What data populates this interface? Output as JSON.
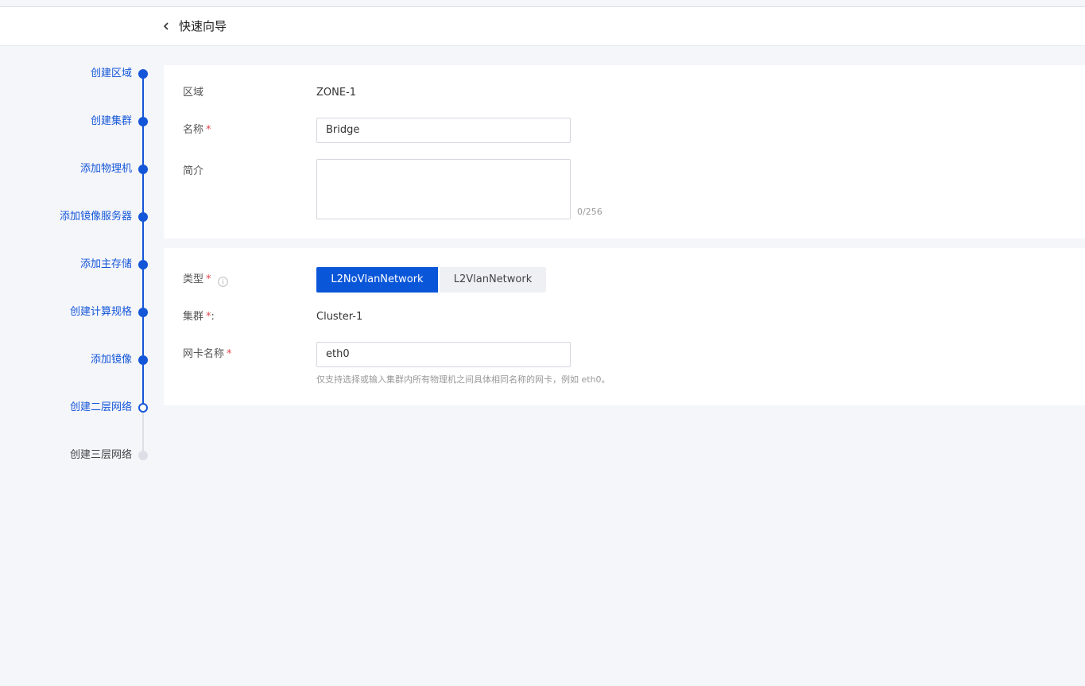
{
  "header": {
    "title": "快速向导"
  },
  "steps": [
    {
      "label": "创建区域",
      "state": "done"
    },
    {
      "label": "创建集群",
      "state": "done"
    },
    {
      "label": "添加物理机",
      "state": "done"
    },
    {
      "label": "添加镜像服务器",
      "state": "done"
    },
    {
      "label": "添加主存储",
      "state": "done"
    },
    {
      "label": "创建计算规格",
      "state": "done"
    },
    {
      "label": "添加镜像",
      "state": "done"
    },
    {
      "label": "创建二层网络",
      "state": "current"
    },
    {
      "label": "创建三层网络",
      "state": "pending"
    }
  ],
  "form": {
    "zone": {
      "label": "区域",
      "value": "ZONE-1"
    },
    "name": {
      "label": "名称",
      "required": "*",
      "value": "Bridge"
    },
    "description": {
      "label": "简介",
      "value": "",
      "counter": "0/256"
    },
    "type": {
      "label": "类型",
      "required": "*",
      "options": [
        "L2NoVlanNetwork",
        "L2VlanNetwork"
      ],
      "selected": "L2NoVlanNetwork"
    },
    "cluster": {
      "label": "集群",
      "required": "*",
      "suffix": ":",
      "value": "Cluster-1"
    },
    "nic": {
      "label": "网卡名称",
      "required": "*",
      "value": "eth0",
      "hint": "仅支持选择或输入集群内所有物理机之间具体相同名称的网卡，例如 eth0。"
    }
  },
  "colors": {
    "primary": "#1456d8",
    "required": "#e5484d",
    "background": "#f5f6fa"
  }
}
